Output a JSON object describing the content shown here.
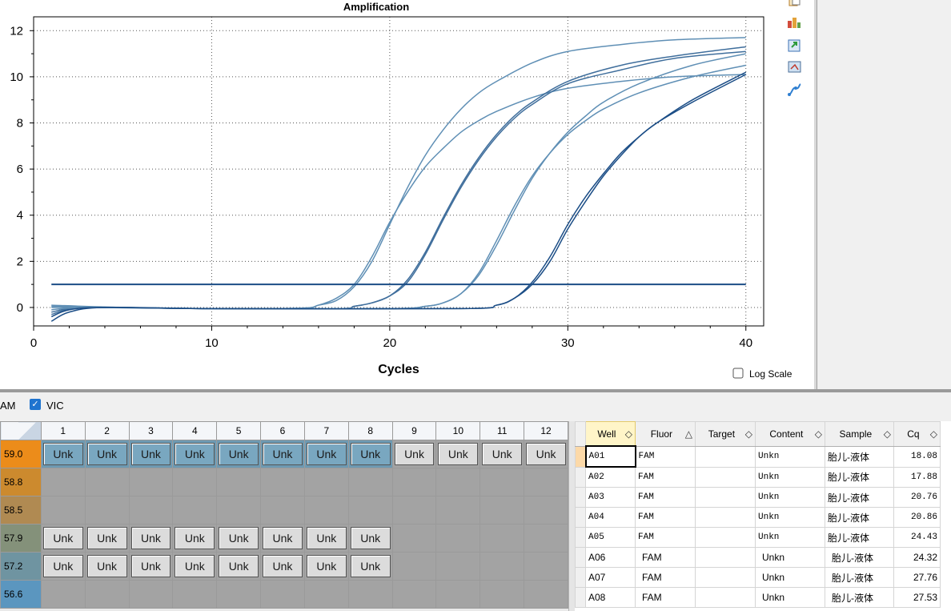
{
  "chart": {
    "title": "Amplification",
    "xlabel": "Cycles",
    "log_scale_label": "Log Scale",
    "y_ticks": [
      "12",
      "10",
      "8",
      "6",
      "4",
      "2",
      "0"
    ],
    "x_ticks": [
      "0",
      "10",
      "20",
      "30",
      "40"
    ]
  },
  "chart_data": {
    "type": "line",
    "title": "Amplification",
    "xlabel": "Cycles",
    "ylabel": "",
    "xlim": [
      0,
      41
    ],
    "ylim": [
      -0.8,
      12.6
    ],
    "threshold": 1.0,
    "threshold_color": "#1b4d86",
    "series": [
      {
        "cq": 18.08,
        "plateau": 11.7,
        "color": "#5f8fb5",
        "values": [
          [
            1,
            0.1
          ],
          [
            5,
            0.0
          ],
          [
            10,
            -0.05
          ],
          [
            15,
            -0.03
          ],
          [
            16,
            0.1
          ],
          [
            17,
            0.3
          ],
          [
            18,
            0.9
          ],
          [
            19,
            2.0
          ],
          [
            20,
            3.6
          ],
          [
            21,
            5.2
          ],
          [
            22,
            6.6
          ],
          [
            23,
            7.7
          ],
          [
            24,
            8.6
          ],
          [
            25,
            9.3
          ],
          [
            26,
            9.8
          ],
          [
            28,
            10.6
          ],
          [
            30,
            11.1
          ],
          [
            33,
            11.4
          ],
          [
            36,
            11.6
          ],
          [
            40,
            11.7
          ]
        ]
      },
      {
        "cq": 17.88,
        "plateau": 10.1,
        "color": "#5f8fb5",
        "values": [
          [
            1,
            0.05
          ],
          [
            5,
            0.0
          ],
          [
            10,
            -0.05
          ],
          [
            15,
            -0.03
          ],
          [
            16,
            0.1
          ],
          [
            17,
            0.4
          ],
          [
            18,
            1.0
          ],
          [
            19,
            2.2
          ],
          [
            20,
            3.7
          ],
          [
            21,
            5.0
          ],
          [
            22,
            6.1
          ],
          [
            23,
            6.9
          ],
          [
            24,
            7.6
          ],
          [
            25,
            8.1
          ],
          [
            26,
            8.5
          ],
          [
            28,
            9.1
          ],
          [
            30,
            9.5
          ],
          [
            33,
            9.8
          ],
          [
            36,
            10.0
          ],
          [
            40,
            10.1
          ]
        ]
      },
      {
        "cq": 20.76,
        "plateau": 11.3,
        "color": "#3f6e9c",
        "values": [
          [
            1,
            -0.3
          ],
          [
            3,
            0.0
          ],
          [
            10,
            -0.05
          ],
          [
            17,
            -0.05
          ],
          [
            18,
            0.05
          ],
          [
            19,
            0.2
          ],
          [
            20,
            0.5
          ],
          [
            21,
            1.2
          ],
          [
            22,
            2.4
          ],
          [
            23,
            3.9
          ],
          [
            24,
            5.3
          ],
          [
            25,
            6.5
          ],
          [
            26,
            7.5
          ],
          [
            27,
            8.3
          ],
          [
            28,
            8.9
          ],
          [
            30,
            9.8
          ],
          [
            33,
            10.5
          ],
          [
            36,
            10.9
          ],
          [
            40,
            11.3
          ]
        ]
      },
      {
        "cq": 20.86,
        "plateau": 11.1,
        "color": "#3f6e9c",
        "values": [
          [
            1,
            -0.2
          ],
          [
            3,
            0.0
          ],
          [
            10,
            -0.05
          ],
          [
            17,
            -0.05
          ],
          [
            18,
            0.05
          ],
          [
            19,
            0.2
          ],
          [
            20,
            0.5
          ],
          [
            21,
            1.1
          ],
          [
            22,
            2.3
          ],
          [
            23,
            3.8
          ],
          [
            24,
            5.2
          ],
          [
            25,
            6.4
          ],
          [
            26,
            7.4
          ],
          [
            27,
            8.2
          ],
          [
            28,
            8.8
          ],
          [
            30,
            9.7
          ],
          [
            33,
            10.3
          ],
          [
            36,
            10.8
          ],
          [
            40,
            11.1
          ]
        ]
      },
      {
        "cq": 24.43,
        "plateau": 11.0,
        "color": "#5f8fb5",
        "values": [
          [
            1,
            -0.1
          ],
          [
            3,
            0.0
          ],
          [
            10,
            -0.05
          ],
          [
            20,
            -0.05
          ],
          [
            22,
            0.05
          ],
          [
            23,
            0.2
          ],
          [
            24,
            0.6
          ],
          [
            25,
            1.4
          ],
          [
            26,
            2.7
          ],
          [
            27,
            4.2
          ],
          [
            28,
            5.6
          ],
          [
            29,
            6.7
          ],
          [
            30,
            7.6
          ],
          [
            31,
            8.3
          ],
          [
            32,
            8.9
          ],
          [
            34,
            9.7
          ],
          [
            37,
            10.5
          ],
          [
            40,
            11.0
          ]
        ]
      },
      {
        "cq": 24.32,
        "plateau": 10.5,
        "color": "#5f8fb5",
        "values": [
          [
            1,
            0.0
          ],
          [
            3,
            0.0
          ],
          [
            10,
            -0.05
          ],
          [
            20,
            -0.05
          ],
          [
            22,
            0.05
          ],
          [
            23,
            0.2
          ],
          [
            24,
            0.6
          ],
          [
            25,
            1.5
          ],
          [
            26,
            2.9
          ],
          [
            27,
            4.4
          ],
          [
            28,
            5.7
          ],
          [
            29,
            6.7
          ],
          [
            30,
            7.5
          ],
          [
            31,
            8.1
          ],
          [
            32,
            8.6
          ],
          [
            34,
            9.3
          ],
          [
            37,
            10.0
          ],
          [
            40,
            10.5
          ]
        ]
      },
      {
        "cq": 27.76,
        "plateau": 10.2,
        "color": "#1b4d86",
        "values": [
          [
            1,
            -0.6
          ],
          [
            2,
            -0.2
          ],
          [
            4,
            0.0
          ],
          [
            10,
            -0.05
          ],
          [
            24,
            -0.05
          ],
          [
            26,
            0.1
          ],
          [
            27,
            0.4
          ],
          [
            28,
            1.0
          ],
          [
            29,
            2.0
          ],
          [
            30,
            3.4
          ],
          [
            31,
            4.6
          ],
          [
            32,
            5.7
          ],
          [
            33,
            6.6
          ],
          [
            34,
            7.4
          ],
          [
            35,
            8.0
          ],
          [
            37,
            9.0
          ],
          [
            40,
            10.2
          ]
        ]
      },
      {
        "cq": 27.53,
        "plateau": 10.1,
        "color": "#1b4d86",
        "values": [
          [
            1,
            -0.4
          ],
          [
            2,
            -0.1
          ],
          [
            4,
            0.0
          ],
          [
            10,
            -0.05
          ],
          [
            24,
            -0.05
          ],
          [
            26,
            0.1
          ],
          [
            27,
            0.4
          ],
          [
            28,
            1.1
          ],
          [
            29,
            2.2
          ],
          [
            30,
            3.6
          ],
          [
            31,
            4.8
          ],
          [
            32,
            5.8
          ],
          [
            33,
            6.7
          ],
          [
            34,
            7.4
          ],
          [
            35,
            8.0
          ],
          [
            37,
            8.9
          ],
          [
            40,
            10.1
          ]
        ]
      }
    ]
  },
  "filter": {
    "fam_label": "AM",
    "vic_label": "VIC"
  },
  "plate": {
    "columns": [
      "1",
      "2",
      "3",
      "4",
      "5",
      "6",
      "7",
      "8",
      "9",
      "10",
      "11",
      "12"
    ],
    "rows": [
      {
        "label": "59.0",
        "color": "#ec8c1a",
        "cells": [
          "Unk",
          "Unk",
          "Unk",
          "Unk",
          "Unk",
          "Unk",
          "Unk",
          "Unk",
          "Unk",
          "Unk",
          "Unk",
          "Unk"
        ],
        "blue_count": 8
      },
      {
        "label": "58.8",
        "color": "#cc8a2e",
        "cells": [],
        "blue_count": 0
      },
      {
        "label": "58.5",
        "color": "#b08a52",
        "cells": [],
        "blue_count": 0
      },
      {
        "label": "57.9",
        "color": "#84917a",
        "cells": [
          "Unk",
          "Unk",
          "Unk",
          "Unk",
          "Unk",
          "Unk",
          "Unk",
          "Unk"
        ],
        "blue_count": 0
      },
      {
        "label": "57.2",
        "color": "#6f94a1",
        "cells": [
          "Unk",
          "Unk",
          "Unk",
          "Unk",
          "Unk",
          "Unk",
          "Unk",
          "Unk"
        ],
        "blue_count": 0
      },
      {
        "label": "56.6",
        "color": "#5b96bf",
        "cells": [],
        "blue_count": 0
      }
    ]
  },
  "grid": {
    "headers": [
      {
        "label": "Well",
        "sort": "◇"
      },
      {
        "label": "Fluor",
        "sort": "△"
      },
      {
        "label": "Target",
        "sort": "◇"
      },
      {
        "label": "Content",
        "sort": "◇"
      },
      {
        "label": "Sample",
        "sort": "◇"
      },
      {
        "label": "Cq",
        "sort": "◇"
      }
    ],
    "rows": [
      {
        "well": "A01",
        "fluor": "FAM",
        "target": "",
        "content": "Unkn",
        "sample": "胎儿-液体",
        "cq": "18.08"
      },
      {
        "well": "A02",
        "fluor": "FAM",
        "target": "",
        "content": "Unkn",
        "sample": "胎儿-液体",
        "cq": "17.88"
      },
      {
        "well": "A03",
        "fluor": "FAM",
        "target": "",
        "content": "Unkn",
        "sample": "胎儿-液体",
        "cq": "20.76"
      },
      {
        "well": "A04",
        "fluor": "FAM",
        "target": "",
        "content": "Unkn",
        "sample": "胎儿-液体",
        "cq": "20.86"
      },
      {
        "well": "A05",
        "fluor": "FAM",
        "target": "",
        "content": "Unkn",
        "sample": "胎儿-液体",
        "cq": "24.43"
      },
      {
        "well": "A06",
        "fluor": "FAM",
        "target": "",
        "content": "Unkn",
        "sample": "胎儿-液体",
        "cq": "24.32"
      },
      {
        "well": "A07",
        "fluor": "FAM",
        "target": "",
        "content": "Unkn",
        "sample": "胎儿-液体",
        "cq": "27.76"
      },
      {
        "well": "A08",
        "fluor": "FAM",
        "target": "",
        "content": "Unkn",
        "sample": "胎儿-液体",
        "cq": "27.53"
      }
    ]
  },
  "toolbar": {
    "icons": [
      "copy-icon",
      "chart-properties-icon",
      "export-icon",
      "zoom-icon",
      "curve-icon"
    ]
  }
}
